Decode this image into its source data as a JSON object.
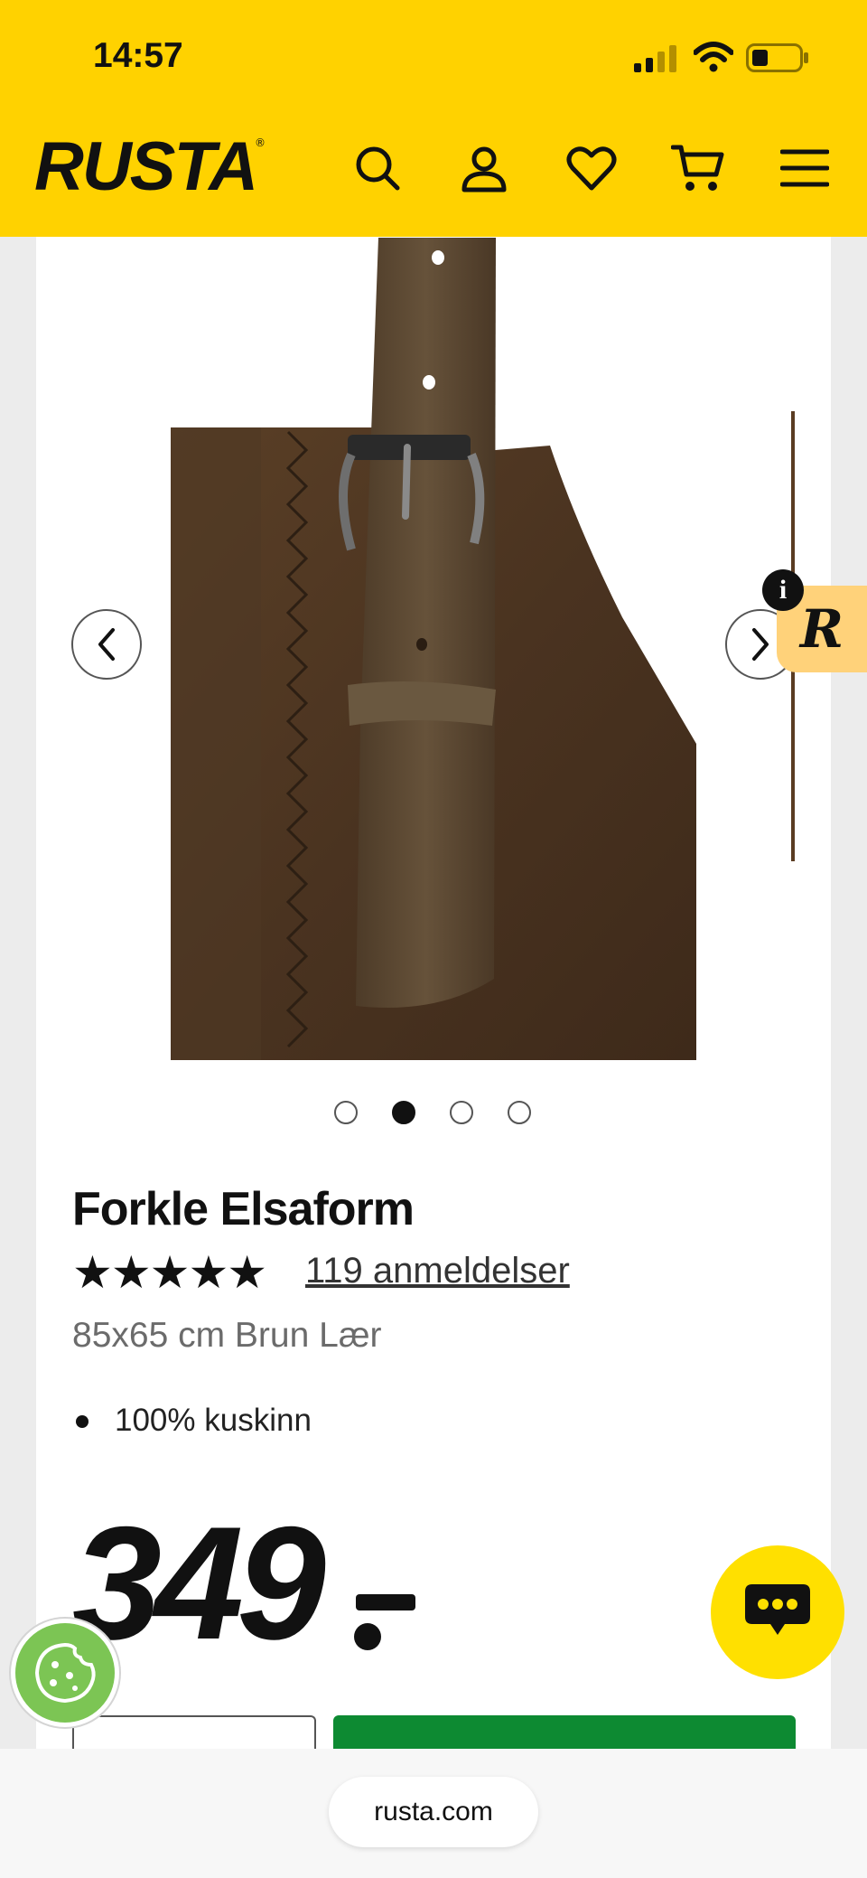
{
  "status_bar": {
    "time": "14:57"
  },
  "header": {
    "logo_text": "RUSTA",
    "logo_mark": "®",
    "icons": [
      "search-icon",
      "account-icon",
      "heart-icon",
      "cart-icon",
      "menu-icon"
    ],
    "background": "#ffd200"
  },
  "gallery": {
    "image_count": 4,
    "active_index": 1,
    "prev_icon": "chevron-left-icon",
    "next_icon": "chevron-right-icon"
  },
  "side_widget": {
    "badge_letter": "R",
    "info_letter": "i",
    "color": "#ffd27a"
  },
  "product": {
    "name": "Forkle Elsaform",
    "rating_stars": "★★★★★",
    "rating": 5,
    "reviews_label": "119 anmeldelser",
    "subtitle": "85x65 cm Brun Lær",
    "features": [
      "100% kuskinn"
    ],
    "price": "349"
  },
  "buy_button_color": "#0d8a32",
  "floating": {
    "chat_icon": "chat-icon",
    "cookie_icon": "cookie-icon"
  },
  "browser": {
    "url": "rusta.com"
  }
}
